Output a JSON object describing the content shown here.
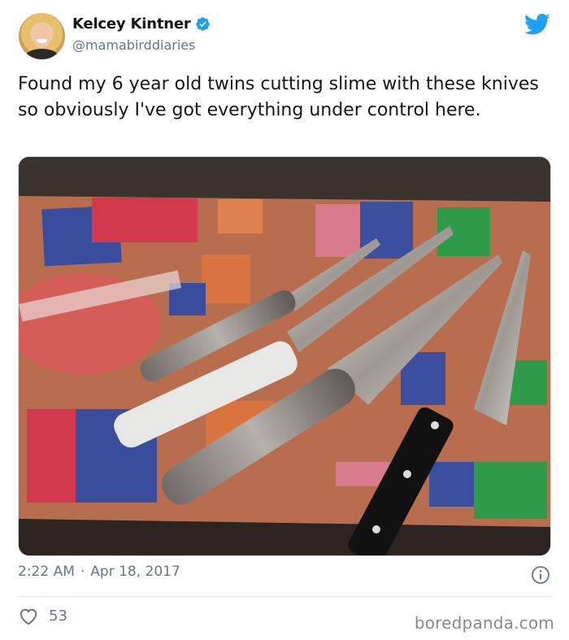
{
  "author": {
    "display_name": "Kelcey Kintner",
    "handle": "@mamabirddiaries",
    "verified": true
  },
  "tweet": {
    "text": "Found my 6 year old twins cutting slime with these knives so obviously I've got everything under control here.",
    "time": "2:22 AM",
    "separator": "·",
    "date": "Apr 18, 2017"
  },
  "engagement": {
    "likes": "53"
  },
  "watermark": "boredpanda.com",
  "colors": {
    "twitter_blue": "#1da1f2",
    "text_primary": "#14171a",
    "text_secondary": "#657786"
  },
  "icons": {
    "brand": "twitter-bird-icon",
    "verified": "verified-badge-icon",
    "info": "info-icon",
    "like": "heart-icon"
  }
}
